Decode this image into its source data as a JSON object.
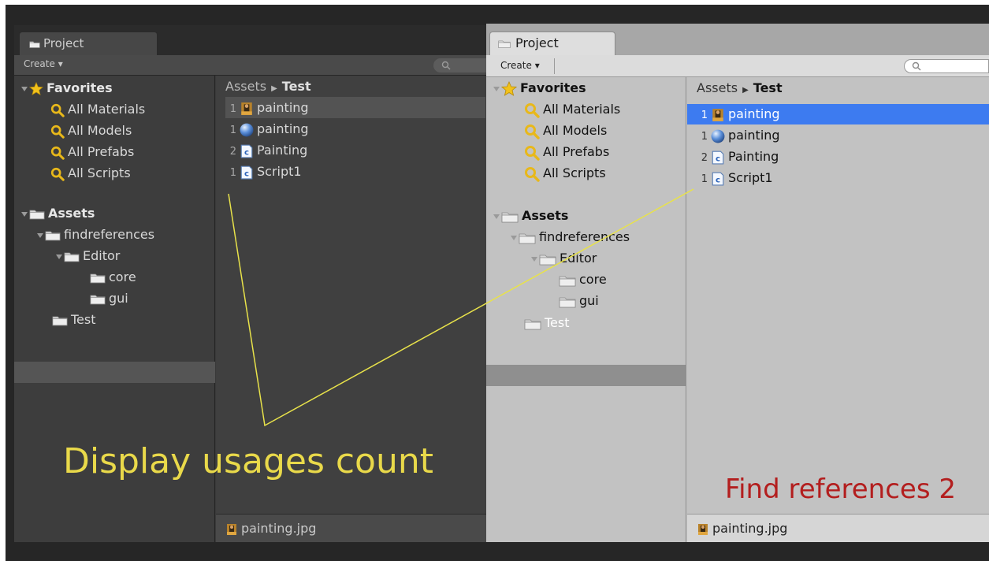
{
  "dark_panel": {
    "tab_title": "Project",
    "create_label": "Create",
    "favorites_label": "Favorites",
    "favorites": [
      "All Materials",
      "All Models",
      "All Prefabs",
      "All Scripts"
    ],
    "assets_label": "Assets",
    "folders": [
      "findreferences",
      "Editor",
      "core",
      "gui",
      "Test"
    ],
    "breadcrumb": {
      "root": "Assets",
      "current": "Test"
    },
    "files": [
      {
        "count": "1",
        "name": "painting",
        "icon": "texture-icon"
      },
      {
        "count": "1",
        "name": "painting",
        "icon": "material-sphere-icon"
      },
      {
        "count": "2",
        "name": "Painting",
        "icon": "script-icon"
      },
      {
        "count": "1",
        "name": "Script1",
        "icon": "script-icon"
      }
    ],
    "footer": "painting.jpg"
  },
  "light_panel": {
    "tab_title": "Project",
    "create_label": "Create",
    "favorites_label": "Favorites",
    "favorites": [
      "All Materials",
      "All Models",
      "All Prefabs",
      "All Scripts"
    ],
    "assets_label": "Assets",
    "folders": [
      "findreferences",
      "Editor",
      "core",
      "gui",
      "Test"
    ],
    "breadcrumb": {
      "root": "Assets",
      "current": "Test"
    },
    "files": [
      {
        "count": "1",
        "name": "painting",
        "icon": "texture-icon"
      },
      {
        "count": "1",
        "name": "painting",
        "icon": "material-sphere-icon"
      },
      {
        "count": "2",
        "name": "Painting",
        "icon": "script-icon"
      },
      {
        "count": "1",
        "name": "Script1",
        "icon": "script-icon"
      }
    ],
    "footer": "painting.jpg"
  },
  "captions": {
    "left": "Display usages count",
    "right": "Find references 2"
  },
  "colors": {
    "caption_left": "#e9d94a",
    "caption_right": "#b31e1e",
    "selection_blue": "#3d7bf0",
    "annotation_line": "#e8e24a"
  }
}
